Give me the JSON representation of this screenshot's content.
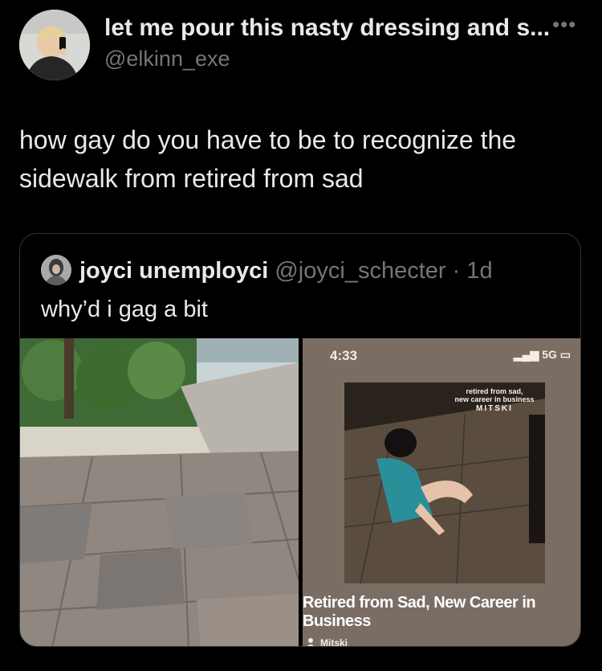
{
  "tweet": {
    "display_name": "let me pour this nasty dressing and s...",
    "handle": "@elkinn_exe",
    "more_icon": "more-horizontal-icon",
    "text": "how gay do you have to be to recognize the sidewalk from retired from sad"
  },
  "quoted_tweet": {
    "display_name": "joyci unemployci",
    "handle": "@joyci_schecter · 1d",
    "text": "why’d i gag a bit"
  },
  "screenshot": {
    "time": "4:33",
    "network": "5G",
    "album_cover_text_1": "retired from sad,",
    "album_cover_text_2": "new career in business",
    "album_cover_logo": "MITSKI",
    "track_title": "Retired from Sad, New Career in Business",
    "artist": "Mitski"
  },
  "colors": {
    "background": "#000000",
    "primary_text": "#e7e9ea",
    "secondary_text": "#71767b",
    "border": "#333639"
  }
}
